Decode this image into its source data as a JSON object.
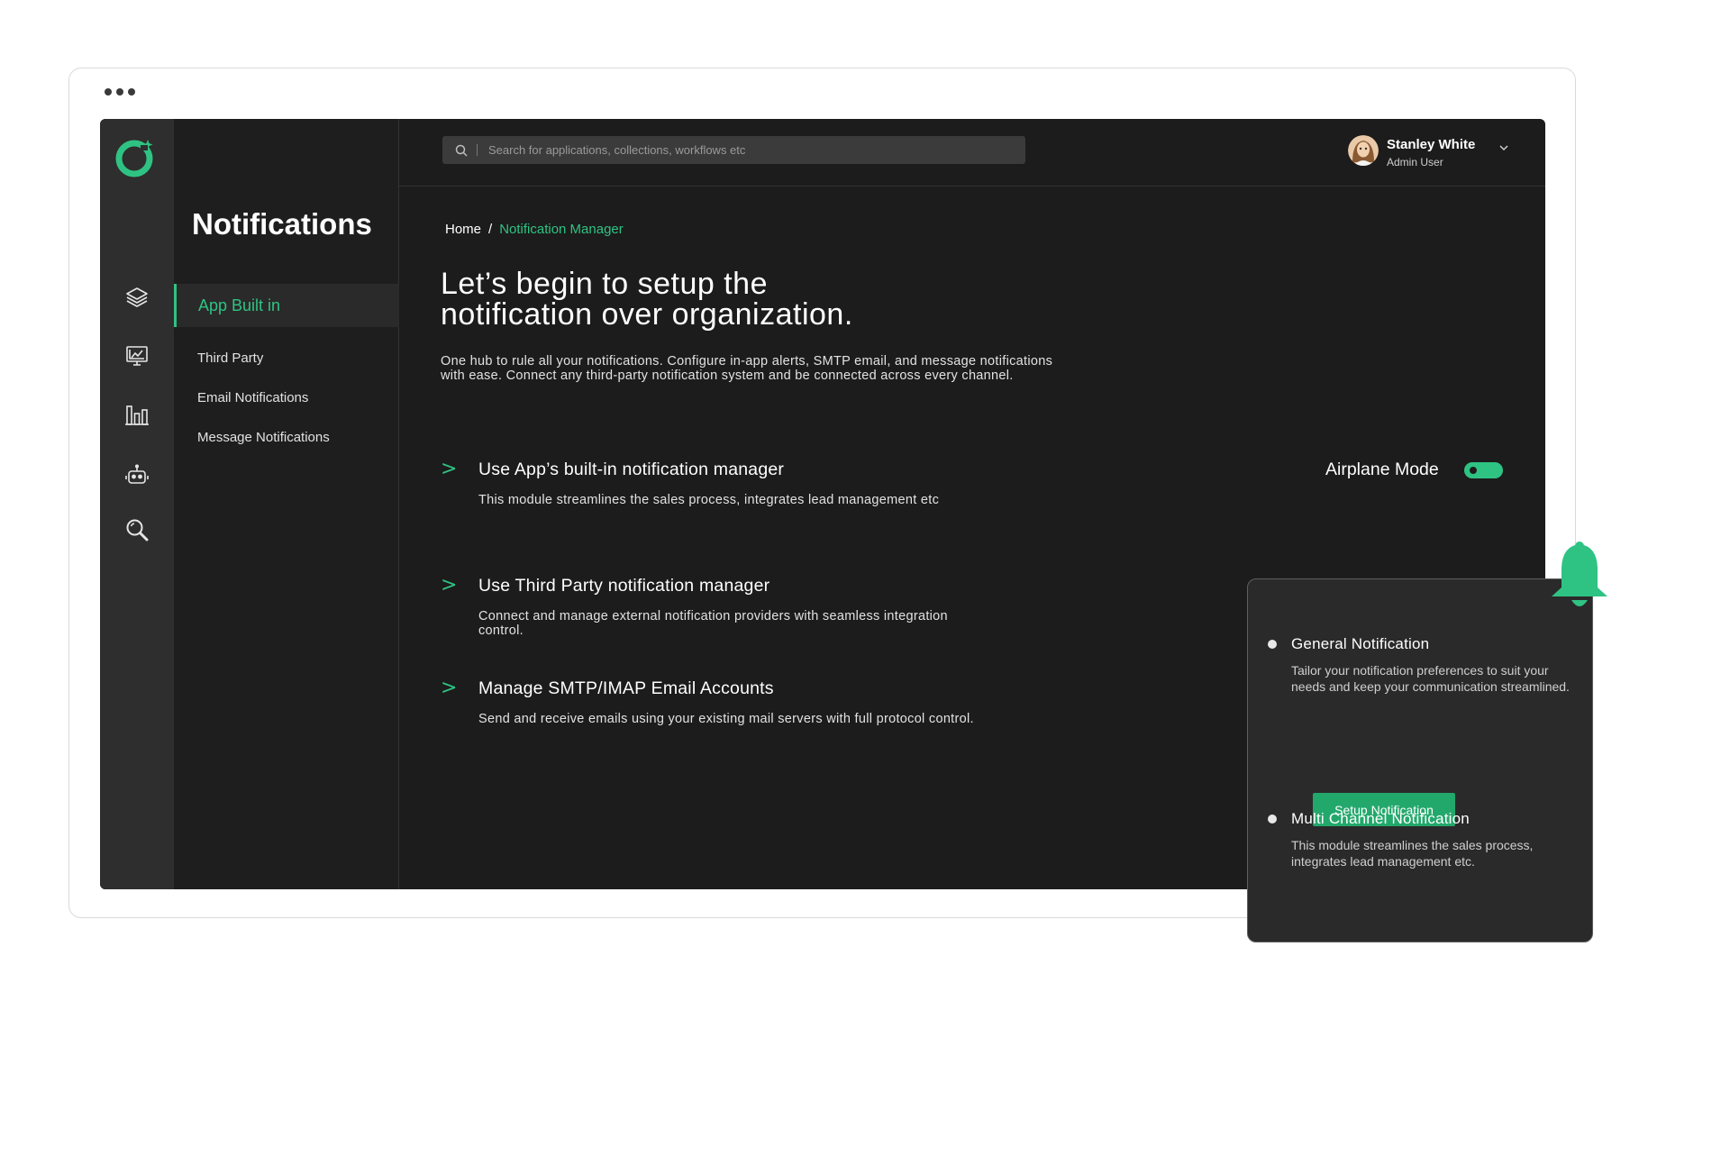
{
  "colors": {
    "accent": "#2fc383",
    "background": "#1c1c1c",
    "rail": "#2e2e2e",
    "card": "#2a2a2a"
  },
  "window": {
    "dots_icon": "ellipsis-icon"
  },
  "rail": {
    "logo": "app-logo",
    "icons": [
      "layers-icon",
      "analytics-monitor-icon",
      "bar-chart-icon",
      "robot-icon",
      "search-icon"
    ]
  },
  "subnav": {
    "title": "Notifications",
    "items": [
      {
        "label": "App Built in",
        "active": true
      },
      {
        "label": "Third Party"
      },
      {
        "label": "Email Notifications"
      },
      {
        "label": "Message Notifications"
      }
    ]
  },
  "search": {
    "placeholder": "Search for applications, collections, workflows etc"
  },
  "user": {
    "name": "Stanley White",
    "role": "Admin User"
  },
  "breadcrumb": {
    "home": "Home",
    "separator": "/",
    "current": "Notification Manager"
  },
  "hero": {
    "title_line1": "Let’s begin to setup the",
    "title_line2": "notification over organization.",
    "description": "One hub to rule all your notifications. Configure in-app alerts, SMTP email, and message notifications with ease. Connect any third-party notification system and be connected across every channel."
  },
  "options": [
    {
      "chevron": ">",
      "title": "Use App’s built-in notification manager",
      "description": "This module streamlines the sales process, integrates lead management etc"
    },
    {
      "chevron": ">",
      "title": "Use Third Party notification manager",
      "description": "Connect and manage external notification providers with seamless integration control."
    },
    {
      "chevron": ">",
      "title": "Manage SMTP/IMAP Email Accounts",
      "description": "Send and receive emails using your existing mail servers with full protocol control."
    }
  ],
  "airplane": {
    "label": "Airplane Mode",
    "enabled": true
  },
  "notification_card": {
    "bell_icon": "bell-icon",
    "items": [
      {
        "title": "General Notification",
        "description": "Tailor your notification preferences to suit your needs and keep your communication streamlined.",
        "button": "Setup Notification"
      },
      {
        "title": "Multi Channel Notification",
        "description": "This module streamlines the sales process, integrates lead management etc."
      }
    ]
  }
}
